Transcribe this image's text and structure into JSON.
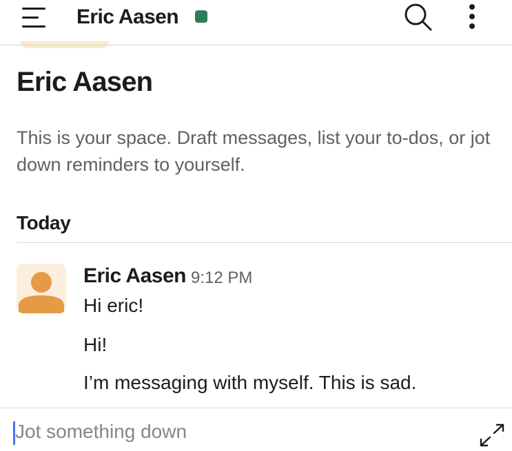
{
  "header": {
    "title": "Eric Aasen",
    "presence_color": "#2f7d5a",
    "menu_icon": "hamburger-menu-icon",
    "search_icon": "search-icon",
    "more_icon": "more-vertical-icon"
  },
  "intro": {
    "name": "Eric Aasen",
    "description": "This is your space. Draft messages, list your to-dos, or jot down reminders to yourself."
  },
  "divider": {
    "label": "Today"
  },
  "message": {
    "author": "Eric Aasen",
    "time": "9:12 PM",
    "avatar_icon": "default-user-avatar-icon",
    "avatar_color": "#e59a45",
    "lines": [
      "Hi eric!",
      "Hi!",
      "I’m messaging with myself. This is sad."
    ]
  },
  "composer": {
    "placeholder": "Jot something down",
    "value": "",
    "expand_icon": "expand-icon"
  }
}
